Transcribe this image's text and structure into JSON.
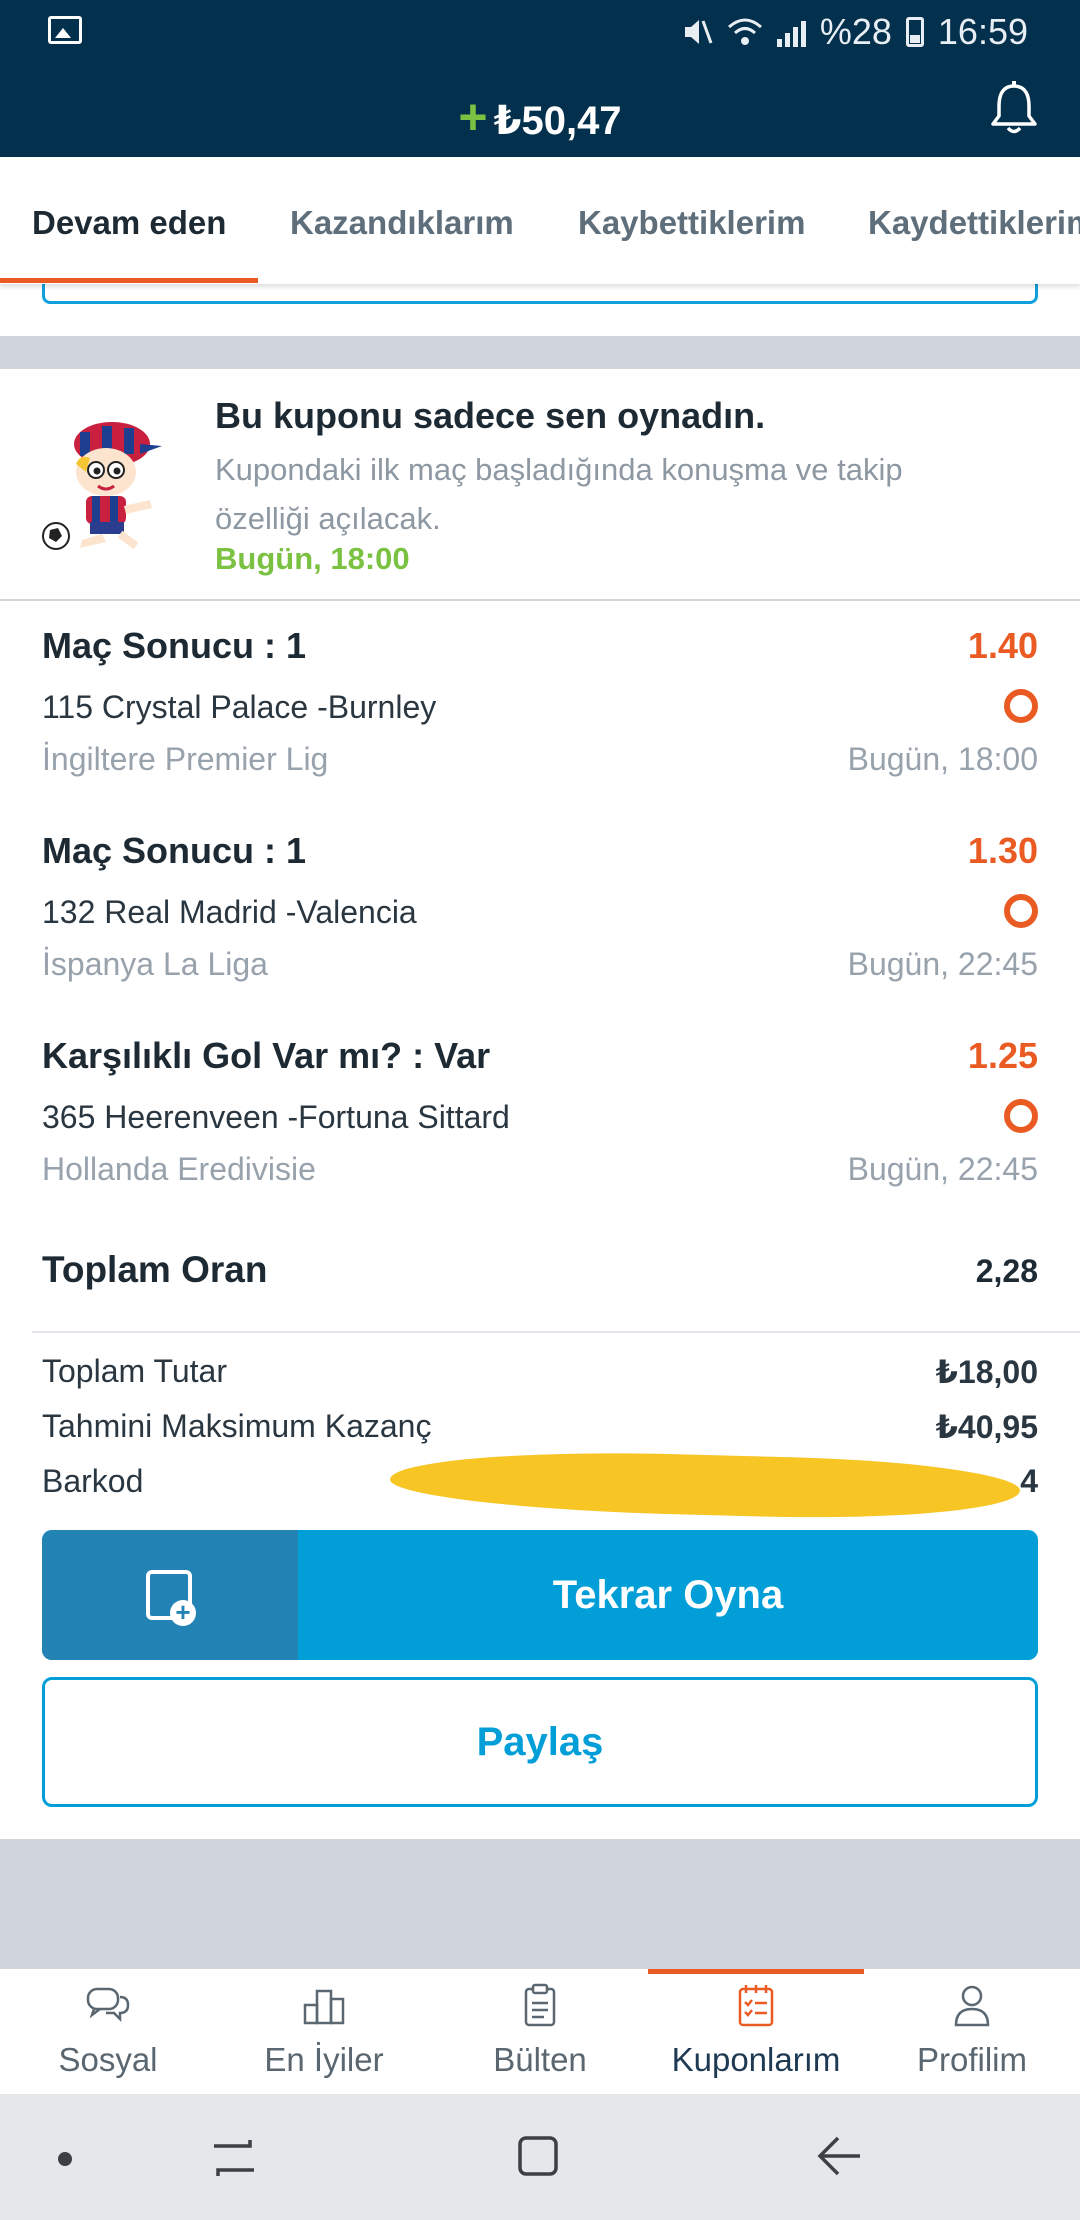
{
  "status_bar": {
    "battery": "%28",
    "time": "16:59"
  },
  "header": {
    "balance": "₺50,47"
  },
  "tabs": [
    {
      "label": "Devam eden"
    },
    {
      "label": "Kazandıklarım"
    },
    {
      "label": "Kaybettiklerim"
    },
    {
      "label": "Kaydettiklerim"
    }
  ],
  "info": {
    "title": "Bu kuponu sadece sen oynadın.",
    "description": "Kupondaki ilk maç başladığında konuşma ve takip özelliği açılacak.",
    "time": "Bugün, 18:00"
  },
  "bets": [
    {
      "market": "Maç Sonucu : 1",
      "odd": "1.40",
      "match": "115 Crystal Palace -Burnley",
      "league": "İngiltere Premier Lig",
      "time": "Bugün, 18:00"
    },
    {
      "market": "Maç Sonucu : 1",
      "odd": "1.30",
      "match": "132 Real Madrid -Valencia",
      "league": "İspanya La Liga",
      "time": "Bugün, 22:45"
    },
    {
      "market": "Karşılıklı Gol Var mı? : Var",
      "odd": "1.25",
      "match": "365 Heerenveen -Fortuna Sittard",
      "league": "Hollanda Eredivisie",
      "time": "Bugün, 22:45"
    }
  ],
  "summary": {
    "total_odds_label": "Toplam Oran",
    "total_odds": "2,28",
    "total_amount_label": "Toplam Tutar",
    "total_amount": "₺18,00",
    "max_win_label": "Tahmini Maksimum Kazanç",
    "max_win": "₺40,95",
    "barcode_label": "Barkod",
    "barcode_tail": "4"
  },
  "actions": {
    "replay": "Tekrar Oyna",
    "share": "Paylaş"
  },
  "bottom_nav": [
    {
      "label": "Sosyal",
      "icon": "chat-icon"
    },
    {
      "label": "En İyiler",
      "icon": "podium-icon"
    },
    {
      "label": "Bülten",
      "icon": "clipboard-icon"
    },
    {
      "label": "Kuponlarım",
      "icon": "coupon-list-icon",
      "active": true
    },
    {
      "label": "Profilim",
      "icon": "user-icon"
    }
  ],
  "colors": {
    "header": "#03304d",
    "accent_orange": "#ea5b24",
    "accent_blue": "#019ed8",
    "accent_green": "#7bc142"
  }
}
